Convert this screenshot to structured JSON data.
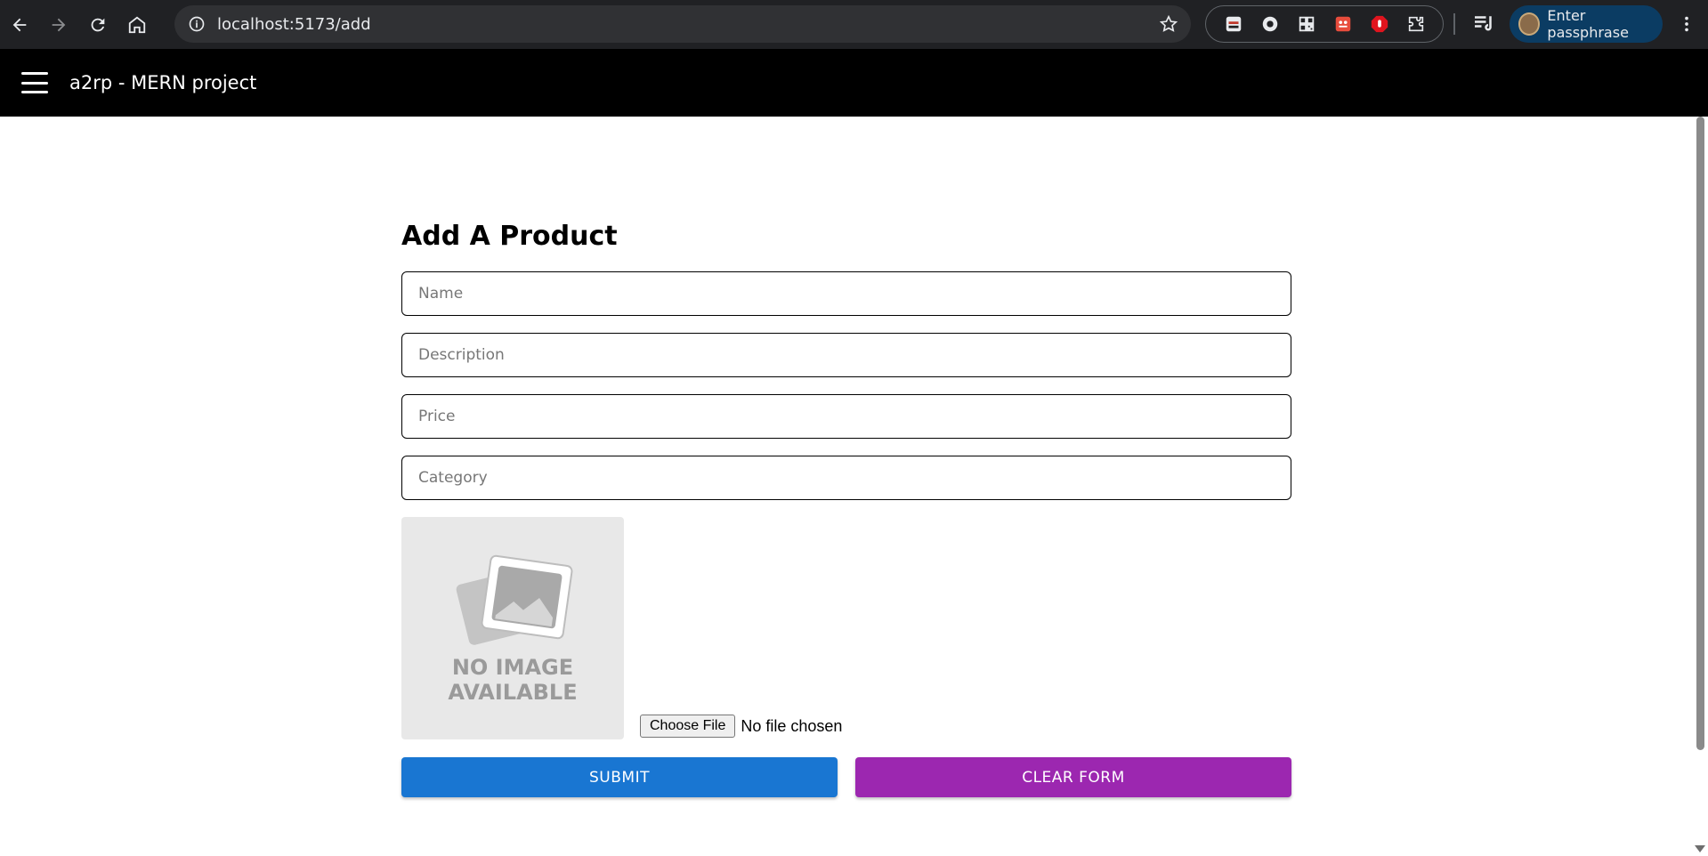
{
  "browser": {
    "url": "localhost:5173/add",
    "profile_label": "Enter passphrase",
    "icons": [
      "back-icon",
      "forward-icon",
      "reload-icon",
      "home-icon",
      "site-info-icon",
      "bookmark-star-icon",
      "extensions-icon",
      "media-controls-icon",
      "menu-kebab-icon"
    ]
  },
  "appbar": {
    "title": "a2rp - MERN project"
  },
  "form": {
    "title": "Add A Product",
    "fields": {
      "name_placeholder": "Name",
      "description_placeholder": "Description",
      "price_placeholder": "Price",
      "category_placeholder": "Category"
    },
    "image_preview": {
      "line1": "NO IMAGE",
      "line2": "AVAILABLE"
    },
    "file_input": {
      "button_label": "Choose File",
      "status": "No file chosen"
    },
    "submit_label": "SUBMIT",
    "clear_label": "CLEAR FORM"
  },
  "colors": {
    "submit": "#1976d2",
    "clear": "#9c27b0",
    "appbar": "#000000"
  }
}
